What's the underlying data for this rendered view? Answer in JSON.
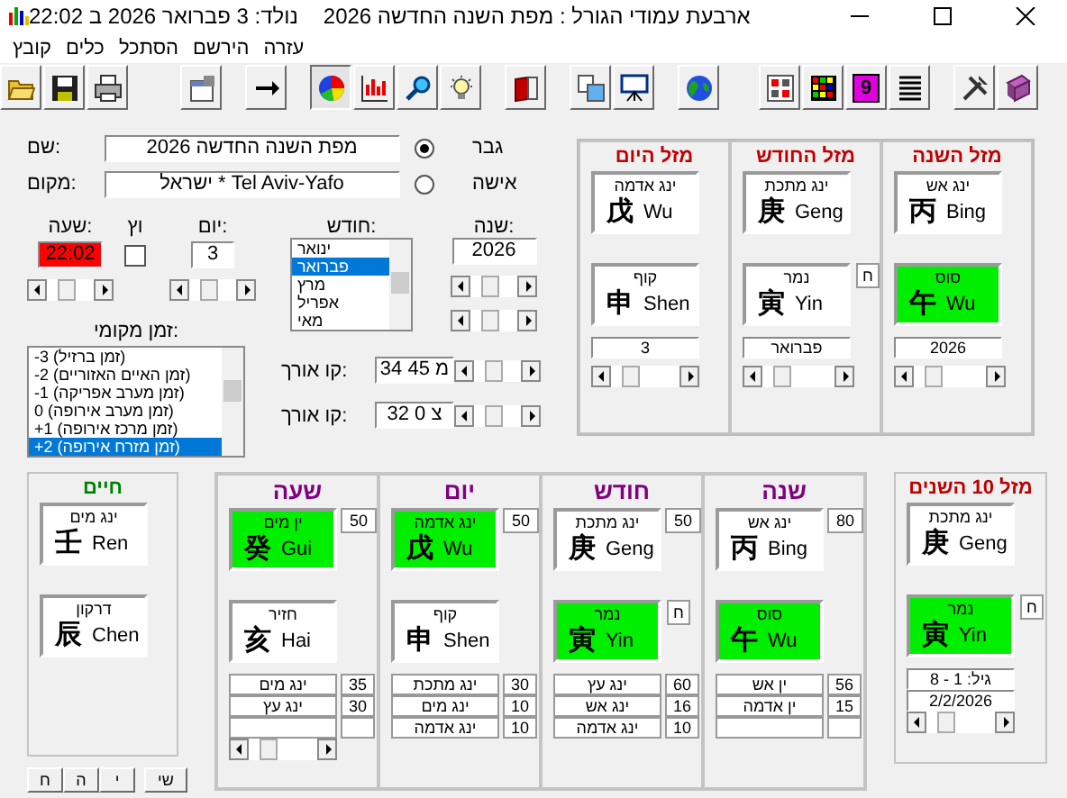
{
  "window": {
    "title": "ארבעת עמודי הגורל : מפת השנה החדשה 2026",
    "subtitle": "נולד: 3 פברואר 2026 ב 22:02"
  },
  "menu": [
    {
      "label": "עזרה"
    },
    {
      "label": "הירשם"
    },
    {
      "label": "הסתכל"
    },
    {
      "label": "כלים"
    },
    {
      "label": "קובץ"
    }
  ],
  "toolbar": [
    [
      {
        "kind": "open",
        "pressed": false
      },
      {
        "kind": "save",
        "pressed": false
      },
      {
        "kind": "print",
        "pressed": false
      }
    ],
    [
      {
        "kind": "properties",
        "pressed": false
      }
    ],
    [
      {
        "kind": "arrow",
        "pressed": false
      }
    ],
    [
      {
        "kind": "pie",
        "pressed": true
      },
      {
        "kind": "chart",
        "pressed": false
      },
      {
        "kind": "search",
        "pressed": false
      },
      {
        "kind": "bulb",
        "pressed": false
      }
    ],
    [
      {
        "kind": "redbook",
        "pressed": false
      }
    ],
    [
      {
        "kind": "copy",
        "pressed": false
      },
      {
        "kind": "easel",
        "pressed": false
      }
    ],
    [
      {
        "kind": "globe",
        "pressed": false
      }
    ],
    [
      {
        "kind": "grid",
        "pressed": false
      },
      {
        "kind": "colorgrid",
        "pressed": false
      },
      {
        "kind": "number",
        "label": "9",
        "pressed": false
      },
      {
        "kind": "lines",
        "pressed": false
      }
    ],
    [
      {
        "kind": "tools",
        "pressed": false
      },
      {
        "kind": "book",
        "pressed": false
      }
    ]
  ],
  "form": {
    "name": {
      "label": "שם:",
      "value": "מפת השנה החדשה 2026"
    },
    "place": {
      "label": "מקום:",
      "value": "ישראל * Tel Aviv-Yafo"
    },
    "gender": [
      {
        "label": "גבר",
        "selected": true
      },
      {
        "label": "אישה",
        "selected": false
      }
    ],
    "hour": {
      "label": "שעה:",
      "value": "22:02"
    },
    "dst": {
      "label": "וץ",
      "checked": false
    },
    "day": {
      "label": "יום:",
      "value": "3"
    },
    "month": {
      "label": "חודש:",
      "items": [
        {
          "label": "ינואר",
          "selected": false
        },
        {
          "label": "פברואר",
          "selected": true
        },
        {
          "label": "מרץ",
          "selected": false
        },
        {
          "label": "אפריל",
          "selected": false
        },
        {
          "label": "מאי",
          "selected": false
        }
      ]
    },
    "year": {
      "label": "שנה:",
      "value": "2026"
    },
    "timezone": {
      "label": "זמן מקומי:",
      "items": [
        {
          "label": "-3 (זמן ברזיל)",
          "selected": false
        },
        {
          "label": "-2 (זמן האיים האזוריים)",
          "selected": false
        },
        {
          "label": "-1 (זמן מערב אפריקה)",
          "selected": false
        },
        {
          "label": "0 (זמן מערב אירופה)",
          "selected": false
        },
        {
          "label": "+1 (זמן מרכז אירופה)",
          "selected": false
        },
        {
          "label": "+2 (זמן מזרח אירופה)",
          "selected": true
        }
      ]
    },
    "longitude": {
      "label": "קו אורך:",
      "value": "34 45 מ"
    },
    "latitude": {
      "label": "קו אורך:",
      "value": "32 0 צ"
    }
  },
  "luck": [
    {
      "title": "מזל השנה",
      "stem": {
        "name": "ינג אש",
        "char": "丙",
        "pinyin": "Bing",
        "highlight": false
      },
      "branch": {
        "name": "סוס",
        "char": "午",
        "pinyin": "Wu",
        "highlight": true
      },
      "value": "2026"
    },
    {
      "title": "מזל החודש",
      "stem": {
        "name": "ינג מתכת",
        "char": "庚",
        "pinyin": "Geng",
        "highlight": false
      },
      "branch": {
        "name": "נמר",
        "char": "寅",
        "pinyin": "Yin",
        "highlight": false,
        "tag": "ח"
      },
      "value": "פברואר"
    },
    {
      "title": "מזל היום",
      "stem": {
        "name": "ינג אדמה",
        "char": "戊",
        "pinyin": "Wu",
        "highlight": false
      },
      "branch": {
        "name": "קוף",
        "char": "申",
        "pinyin": "Shen",
        "highlight": false
      },
      "value": "3"
    }
  ],
  "life": {
    "title": "חיים",
    "stem": {
      "name": "ינג מים",
      "char": "壬",
      "pinyin": "Ren",
      "highlight": false
    },
    "branch": {
      "name": "דרקון",
      "char": "辰",
      "pinyin": "Chen",
      "highlight": false
    },
    "buttons": [
      {
        "label": "שי"
      },
      {
        "label": "י"
      },
      {
        "label": "ה"
      },
      {
        "label": "ח"
      }
    ]
  },
  "pillars": [
    {
      "title": "שנה",
      "stem": {
        "name": "ינג אש",
        "char": "丙",
        "pinyin": "Bing",
        "highlight": false,
        "score": "80"
      },
      "branch": {
        "name": "סוס",
        "char": "午",
        "pinyin": "Wu",
        "highlight": true
      },
      "rows": [
        {
          "name": "ין אש",
          "score": "56"
        },
        {
          "name": "ין אדמה",
          "score": "15"
        }
      ],
      "scrollbar": false
    },
    {
      "title": "חודש",
      "stem": {
        "name": "ינג מתכת",
        "char": "庚",
        "pinyin": "Geng",
        "highlight": false,
        "score": "50"
      },
      "branch": {
        "name": "נמר",
        "char": "寅",
        "pinyin": "Yin",
        "highlight": true,
        "tag": "ח"
      },
      "rows": [
        {
          "name": "ינג עץ",
          "score": "60"
        },
        {
          "name": "ינג אש",
          "score": "16"
        },
        {
          "name": "ינג אדמה",
          "score": "10"
        }
      ],
      "scrollbar": false
    },
    {
      "title": "יום",
      "stem": {
        "name": "ינג אדמה",
        "char": "戊",
        "pinyin": "Wu",
        "highlight": true,
        "score": "50"
      },
      "branch": {
        "name": "קוף",
        "char": "申",
        "pinyin": "Shen",
        "highlight": false
      },
      "rows": [
        {
          "name": "ינג מתכת",
          "score": "30"
        },
        {
          "name": "ינג מים",
          "score": "10"
        },
        {
          "name": "ינג אדמה",
          "score": "10"
        }
      ],
      "scrollbar": false
    },
    {
      "title": "שעה",
      "stem": {
        "name": "ין מים",
        "char": "癸",
        "pinyin": "Gui",
        "highlight": true,
        "score": "50"
      },
      "branch": {
        "name": "חזיר",
        "char": "亥",
        "pinyin": "Hai",
        "highlight": false
      },
      "rows": [
        {
          "name": "ינג מים",
          "score": "35"
        },
        {
          "name": "ינג עץ",
          "score": "30"
        }
      ],
      "scrollbar": true
    }
  ],
  "decade": {
    "title": "מזל 10 השנים",
    "stem": {
      "name": "ינג מתכת",
      "char": "庚",
      "pinyin": "Geng",
      "highlight": false
    },
    "branch": {
      "name": "נמר",
      "char": "寅",
      "pinyin": "Yin",
      "highlight": true,
      "tag": "ח"
    },
    "age": "גיל: 1 - 8",
    "date": "2/2/2026"
  }
}
